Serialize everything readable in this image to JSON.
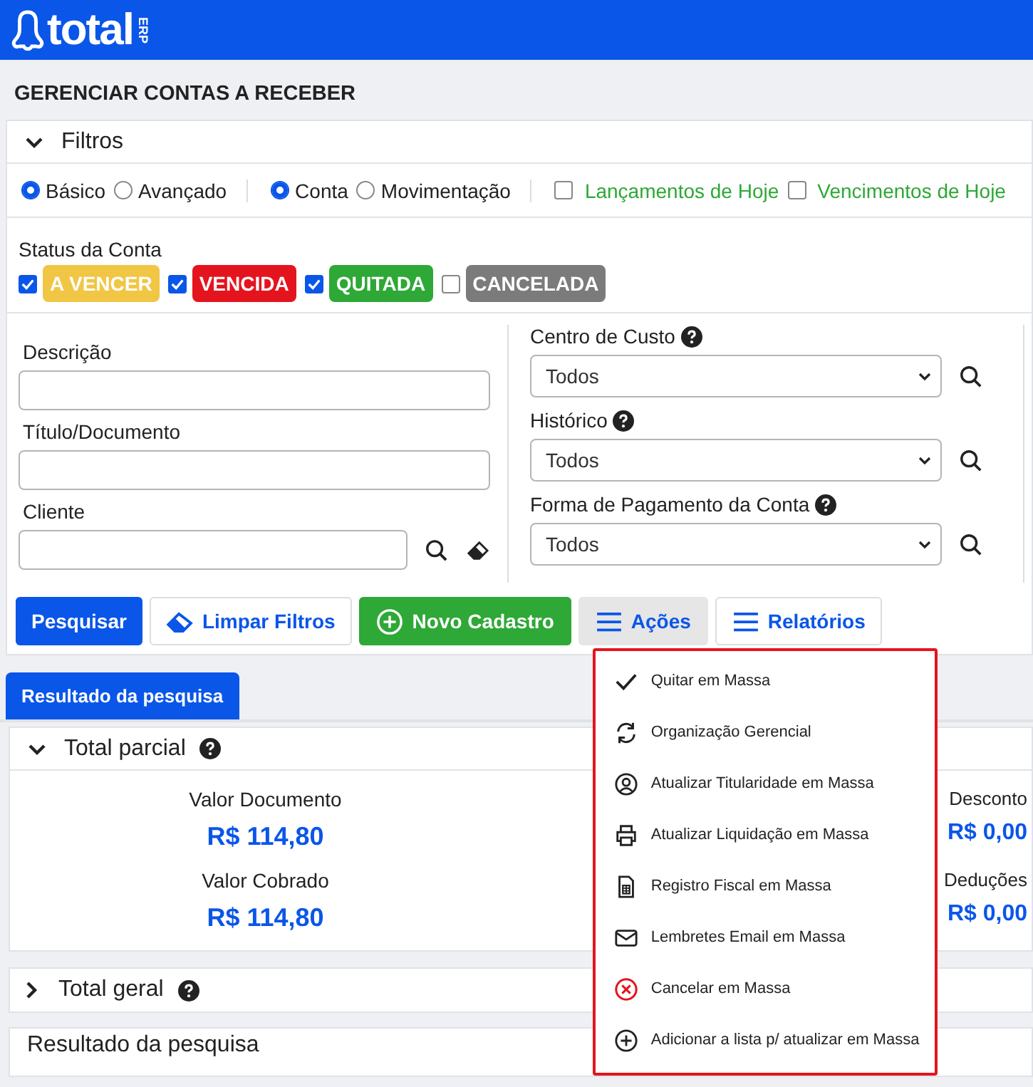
{
  "header": {
    "logo_text": "total",
    "logo_suffix": "ERP"
  },
  "page_title": "GERENCIAR CONTAS A RECEBER",
  "filters": {
    "title": "Filtros",
    "expanded": true,
    "mode_options": [
      {
        "label": "Básico",
        "selected": true
      },
      {
        "label": "Avançado",
        "selected": false
      }
    ],
    "scope_options": [
      {
        "label": "Conta",
        "selected": true
      },
      {
        "label": "Movimentação",
        "selected": false
      }
    ],
    "quick_filters": [
      {
        "label": "Lançamentos de Hoje",
        "checked": false
      },
      {
        "label": "Vencimentos de Hoje",
        "checked": false
      }
    ],
    "status_label": "Status da Conta",
    "statuses": [
      {
        "label": "A VENCER",
        "checked": true,
        "color": "#f0c644"
      },
      {
        "label": "VENCIDA",
        "checked": true,
        "color": "#e4141e"
      },
      {
        "label": "QUITADA",
        "checked": true,
        "color": "#2ea836"
      },
      {
        "label": "CANCELADA",
        "checked": false,
        "color": "#7b7b7b"
      }
    ],
    "text_fields": [
      {
        "label": "Descrição",
        "kind": "text"
      },
      {
        "label": "Título/Documento",
        "kind": "text"
      },
      {
        "label": "Cliente",
        "kind": "lookup"
      }
    ],
    "select_fields": [
      {
        "label": "Centro de Custo",
        "value": "Todos"
      },
      {
        "label": "Histórico",
        "value": "Todos"
      },
      {
        "label": "Forma de Pagamento da Conta",
        "value": "Todos"
      }
    ],
    "buttons": [
      {
        "label": "Pesquisar",
        "kind": "primary"
      },
      {
        "label": "Limpar Filtros",
        "kind": "clear"
      },
      {
        "label": "Novo Cadastro",
        "kind": "create"
      },
      {
        "label": "Ações",
        "kind": "menu",
        "expanded": true
      },
      {
        "label": "Relatórios",
        "kind": "menu",
        "expanded": false
      }
    ]
  },
  "actions_menu": {
    "items": [
      {
        "label": "Quitar em Massa",
        "kind": "check"
      },
      {
        "label": "Organização Gerencial",
        "kind": "sync"
      },
      {
        "label": "Atualizar Titularidade em Massa",
        "kind": "user"
      },
      {
        "label": "Atualizar Liquidação em Massa",
        "kind": "printer"
      },
      {
        "label": "Registro Fiscal em Massa",
        "kind": "document"
      },
      {
        "label": "Lembretes Email em Massa",
        "kind": "mail"
      },
      {
        "label": "Cancelar em Massa",
        "kind": "cancel"
      },
      {
        "label": "Adicionar a lista p/ atualizar em Massa",
        "kind": "add"
      }
    ]
  },
  "results": {
    "tab": "Resultado da pesquisa",
    "total_parcial": {
      "title": "Total parcial",
      "expanded": true,
      "stats": [
        {
          "label": "Valor Documento",
          "value": "R$ 114,80"
        },
        {
          "label": "Desconto",
          "value": "R$ 0,00"
        },
        {
          "label": "Valor Cobrado",
          "value": "R$ 114,80"
        },
        {
          "label": "Deduções",
          "value": "R$ 0,00"
        }
      ]
    },
    "total_geral": {
      "title": "Total geral",
      "expanded": false
    },
    "list_title": "Resultado da pesquisa"
  }
}
